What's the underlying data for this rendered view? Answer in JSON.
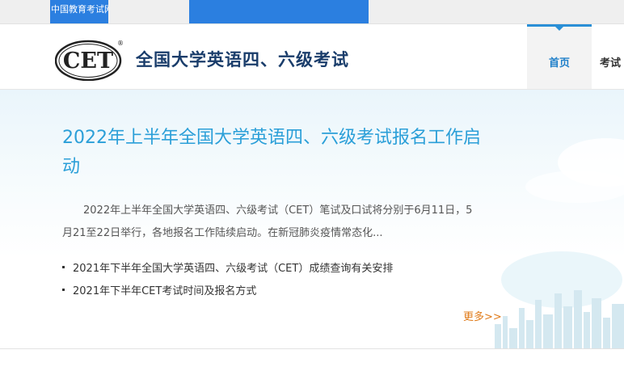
{
  "topbar": {
    "site_link": "中国教育考试网"
  },
  "header": {
    "logo_text": "CET",
    "logo_mark": "®",
    "site_title": "全国大学英语四、六级考试",
    "nav": {
      "home": "首页",
      "exam": "考试"
    }
  },
  "main": {
    "headline": "2022年上半年全国大学英语四、六级考试报名工作启动",
    "summary": "2022年上半年全国大学英语四、六级考试（CET）笔试及口试将分别于6月11日，5月21至22日举行，各地报名工作陆续启动。在新冠肺炎疫情常态化...",
    "news_items": [
      "2021年下半年全国大学英语四、六级考试（CET）成绩查询有关安排",
      "2021年下半年CET考试时间及报名方式"
    ],
    "more_label": "更多>>"
  },
  "colors": {
    "accent_blue": "#2b7fe0",
    "headline_blue": "#2b9fd8",
    "title_navy": "#1a3d6b",
    "more_orange": "#e07b1a"
  }
}
